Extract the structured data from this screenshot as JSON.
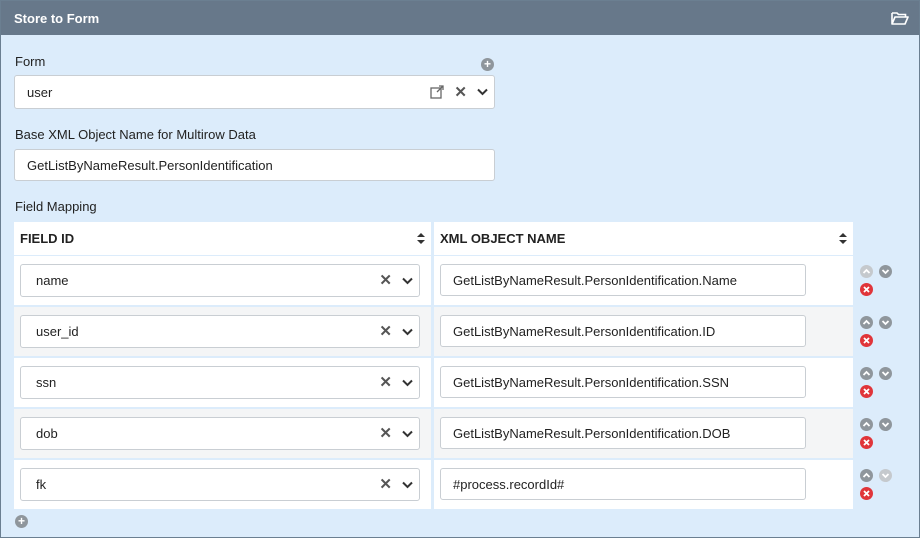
{
  "panel": {
    "title": "Store to Form",
    "header_icon": "folder-open-icon"
  },
  "form": {
    "label": "Form",
    "value": "user"
  },
  "base_xml": {
    "label": "Base XML Object Name for Multirow Data",
    "value": "GetListByNameResult.PersonIdentification"
  },
  "field_mapping": {
    "label": "Field Mapping",
    "columns": [
      "FIELD ID",
      "XML OBJECT NAME"
    ],
    "rows": [
      {
        "field_id": "name",
        "xml_object_name": "GetListByNameResult.PersonIdentification.Name"
      },
      {
        "field_id": "user_id",
        "xml_object_name": "GetListByNameResult.PersonIdentification.ID"
      },
      {
        "field_id": "ssn",
        "xml_object_name": "GetListByNameResult.PersonIdentification.SSN"
      },
      {
        "field_id": "dob",
        "xml_object_name": "GetListByNameResult.PersonIdentification.DOB"
      },
      {
        "field_id": "fk",
        "xml_object_name": "#process.recordId#"
      }
    ]
  },
  "colors": {
    "header_bg": "#67788a",
    "panel_bg": "#dcecfb",
    "delete": "#e0353a"
  }
}
